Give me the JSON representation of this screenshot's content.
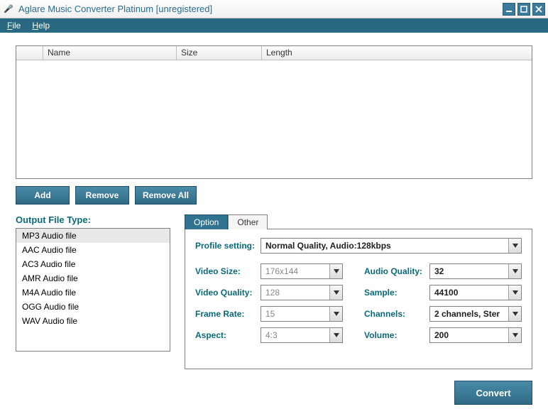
{
  "window": {
    "title": "Aglare Music Converter Platinum  [unregistered]"
  },
  "menu": {
    "file": "File",
    "help": "Help"
  },
  "table": {
    "columns": {
      "name": "Name",
      "size": "Size",
      "length": "Length"
    }
  },
  "toolbar": {
    "add": "Add",
    "remove": "Remove",
    "remove_all": "Remove All"
  },
  "output": {
    "label": "Output File Type:",
    "items": [
      "MP3 Audio file",
      "AAC Audio file",
      "AC3 Audio file",
      "AMR Audio file",
      "M4A Audio file",
      "OGG Audio file",
      "WAV Audio file"
    ]
  },
  "tabs": {
    "option": "Option",
    "other": "Other"
  },
  "settings": {
    "profile_label": "Profile setting:",
    "profile_value": "Normal Quality, Audio:128kbps",
    "video_size_label": "Video Size:",
    "video_size_value": "176x144",
    "video_quality_label": "Video Quality:",
    "video_quality_value": "128",
    "frame_rate_label": "Frame Rate:",
    "frame_rate_value": "15",
    "aspect_label": "Aspect:",
    "aspect_value": "4:3",
    "audio_quality_label": "Audio Quality:",
    "audio_quality_value": "32",
    "sample_label": "Sample:",
    "sample_value": "44100",
    "channels_label": "Channels:",
    "channels_value": "2 channels, Ster",
    "volume_label": "Volume:",
    "volume_value": "200"
  },
  "convert": {
    "label": "Convert"
  }
}
